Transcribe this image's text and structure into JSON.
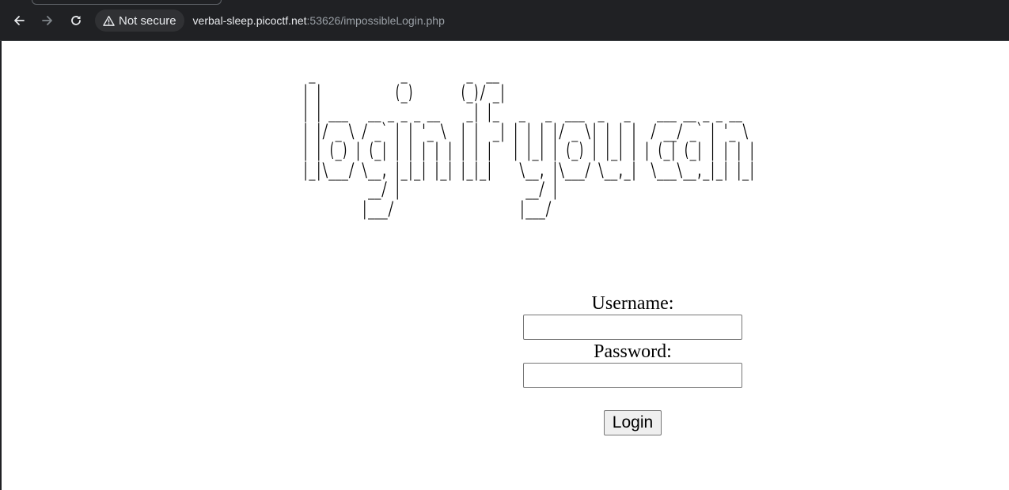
{
  "browser": {
    "security_label": "Not secure",
    "url_host": "verbal-sleep.picoctf.net",
    "url_rest": ":53626/impossibleLogin.php",
    "icons": {
      "back": "arrow-left-icon",
      "forward": "arrow-right-icon",
      "reload": "reload-icon",
      "security": "warning-triangle-icon"
    }
  },
  "page": {
    "ascii_banner": " _             _         _  __\n| |           (_)       (_)/ _|\n| | ___   __ _ _ _ __    _| |_   _   _  ___  _   _    ___ __ _ _ __\n| |/ _ \\ / _` | | '_ \\  | |  _| | | | |/ _ \\| | | |  / __/ _` | '_ \\\n| | (_) | (_| | | | | | | | |   | |_| | (_) | |_| | | (_| (_| | | | |\n|_|\\___/ \\__, |_|_| |_| |_|_|    \\__, |\\___/ \\__,_|  \\___\\__,_|_| |_|\n          __/ |                   __/ |\n         |___/                   |___/",
    "form": {
      "username_label": "Username:",
      "username_value": "",
      "password_label": "Password:",
      "password_value": "",
      "submit_label": "Login"
    }
  },
  "colors": {
    "toolbar_bg": "#202124",
    "chip_bg": "#303134",
    "url_host": "#e8eaed",
    "url_path": "#9aa0a6",
    "page_bg": "#ffffff"
  }
}
